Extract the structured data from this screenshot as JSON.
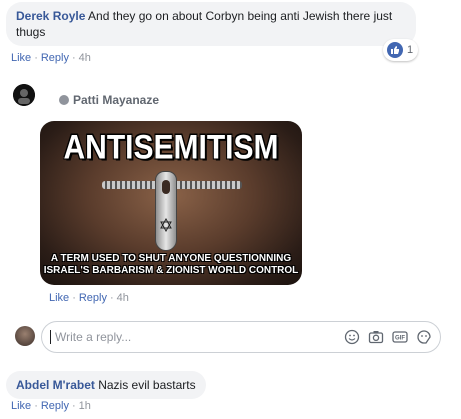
{
  "comment1": {
    "author": "Derek Royle",
    "text": "And they go on about Corbyn being anti Jewish there just thugs",
    "actions": {
      "like": "Like",
      "reply": "Reply",
      "time": "4h"
    },
    "reaction_count": "1"
  },
  "comment2": {
    "author": "Patti Mayanaze",
    "meme": {
      "title": "ANTISEMITISM",
      "caption_line1": "A TERM USED TO SHUT ANYONE QUESTIONNING",
      "caption_line2": "ISRAEL'S BARBARISM & ZIONIST WORLD CONTROL"
    },
    "actions": {
      "like": "Like",
      "reply": "Reply",
      "time": "4h"
    }
  },
  "reply_box": {
    "placeholder": "Write a reply...",
    "icons": [
      "smiley-icon",
      "camera-icon",
      "gif-icon",
      "sticker-icon"
    ]
  },
  "comment3": {
    "author": "Abdel M'rabet",
    "text": "Nazis evil bastarts",
    "actions": {
      "like": "Like",
      "reply": "Reply",
      "time": "1h"
    }
  },
  "colors": {
    "link": "#385898",
    "action_link": "#4267b2",
    "bubble": "#f2f3f5",
    "muted": "#90949c"
  }
}
